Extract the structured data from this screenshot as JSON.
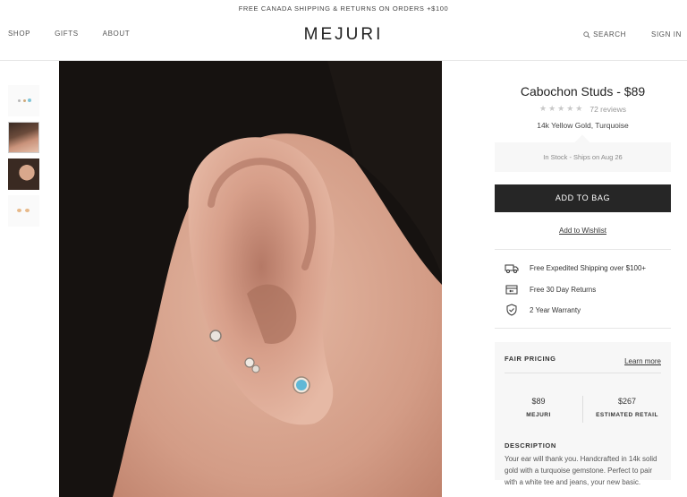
{
  "promo": "FREE CANADA SHIPPING & RETURNS ON ORDERS +$100",
  "nav": {
    "left": [
      "SHOP",
      "GIFTS",
      "ABOUT"
    ],
    "logo": "MEJURI",
    "search": "SEARCH",
    "signin": "SIGN IN"
  },
  "product": {
    "title": "Cabochon Studs - $89",
    "stars": "★★★★★",
    "reviews": "72 reviews",
    "variant": "14k Yellow Gold, Turquoise",
    "stock": "In Stock - Ships on Aug 26",
    "add_to_bag": "ADD TO BAG",
    "wishlist": "Add to Wishlist"
  },
  "perks": [
    {
      "icon": "delivery-van-icon",
      "label": "Free Expedited Shipping over $100+"
    },
    {
      "icon": "return-box-icon",
      "label": "Free 30 Day Returns"
    },
    {
      "icon": "shield-check-icon",
      "label": "2 Year Warranty"
    }
  ],
  "fair_pricing": {
    "title": "FAIR PRICING",
    "learn_more": "Learn more",
    "mejuri_price": "$89",
    "mejuri_label": "MEJURI",
    "retail_price": "$267",
    "retail_label": "ESTIMATED RETAIL"
  },
  "description": {
    "title": "DESCRIPTION",
    "text": "Your ear will thank you. Handcrafted in 14k solid gold with a turquoise gemstone. Perfect to pair with a white tee and jeans, your new basic."
  },
  "colors": {
    "dark_button": "#262626",
    "panel_bg": "#f7f7f7",
    "turquoise": "#5fb8d6"
  }
}
